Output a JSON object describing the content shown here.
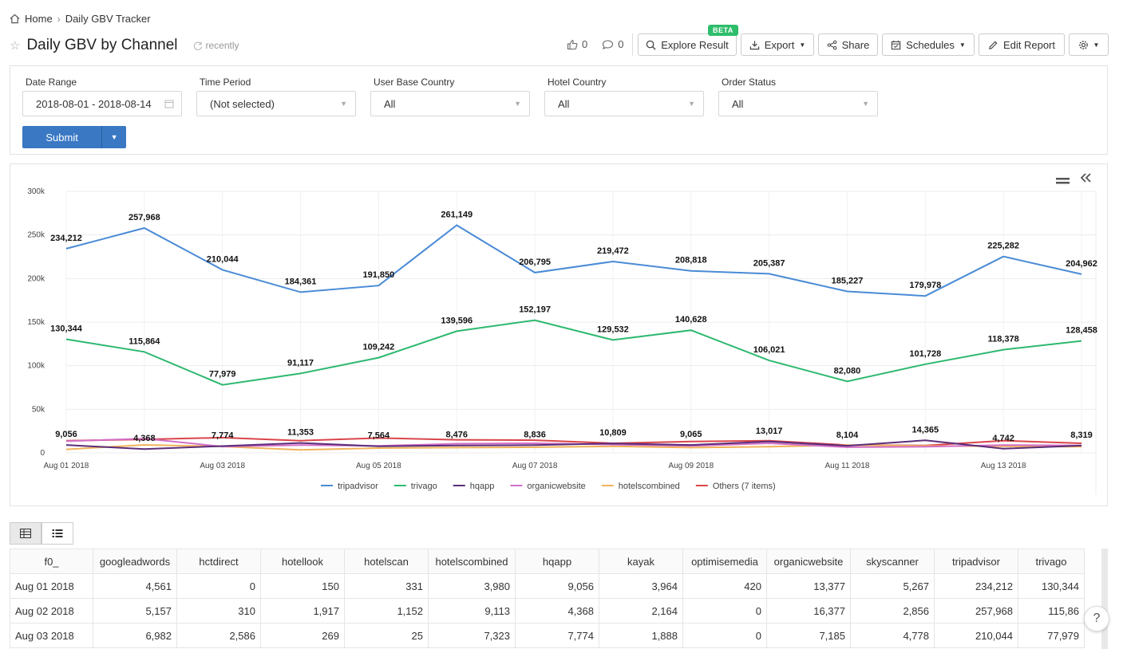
{
  "breadcrumb": {
    "home": "Home",
    "current": "Daily GBV Tracker"
  },
  "report": {
    "title": "Daily GBV by Channel",
    "refresh_text": "recently"
  },
  "counters": {
    "likes": "0",
    "comments": "0"
  },
  "toolbar": {
    "explore_label": "Explore Result",
    "beta_label": "BETA",
    "export_label": "Export",
    "share_label": "Share",
    "schedules_label": "Schedules",
    "edit_label": "Edit Report"
  },
  "filters": {
    "date_range": {
      "label": "Date Range",
      "value": "2018-08-01 - 2018-08-14"
    },
    "time_period": {
      "label": "Time Period",
      "value": "(Not selected)"
    },
    "user_base_country": {
      "label": "User Base Country",
      "value": "All"
    },
    "hotel_country": {
      "label": "Hotel Country",
      "value": "All"
    },
    "order_status": {
      "label": "Order Status",
      "value": "All"
    },
    "submit_label": "Submit"
  },
  "chart_data": {
    "type": "line",
    "x": [
      "Aug 01 2018",
      "Aug 02 2018",
      "Aug 03 2018",
      "Aug 04 2018",
      "Aug 05 2018",
      "Aug 06 2018",
      "Aug 07 2018",
      "Aug 08 2018",
      "Aug 09 2018",
      "Aug 10 2018",
      "Aug 11 2018",
      "Aug 12 2018",
      "Aug 13 2018",
      "Aug 14 2018"
    ],
    "x_tick_labels": [
      "Aug 01 2018",
      "Aug 03 2018",
      "Aug 05 2018",
      "Aug 07 2018",
      "Aug 09 2018",
      "Aug 11 2018",
      "Aug 13 2018"
    ],
    "y_ticks": [
      "0",
      "50k",
      "100k",
      "150k",
      "200k",
      "250k",
      "300k"
    ],
    "ylim": [
      0,
      300000
    ],
    "grid": true,
    "legend_position": "bottom",
    "series": [
      {
        "name": "tripadvisor",
        "color": "#4a8bd6",
        "labeled": true,
        "values": [
          234212,
          257968,
          210044,
          184361,
          191850,
          261149,
          206795,
          219472,
          208818,
          205387,
          185227,
          179978,
          225282,
          204962
        ],
        "labels": [
          "234,212",
          "257,968",
          "210,044",
          "184,361",
          "191,850",
          "261,149",
          "206,795",
          "219,472",
          "208,818",
          "205,387",
          "185,227",
          "179,978",
          "225,282",
          "204,962"
        ]
      },
      {
        "name": "trivago",
        "color": "#2eb870",
        "labeled": true,
        "values": [
          130344,
          115864,
          77979,
          91117,
          109242,
          139596,
          152197,
          129532,
          140628,
          106021,
          82080,
          101728,
          118378,
          128458
        ],
        "labels": [
          "130,344",
          "115,864",
          "77,979",
          "91,117",
          "109,242",
          "139,596",
          "152,197",
          "129,532",
          "140,628",
          "106,021",
          "82,080",
          "101,728",
          "118,378",
          "128,458"
        ]
      },
      {
        "name": "hqapp",
        "color": "#5b2d7a",
        "labeled": true,
        "values": [
          9056,
          4368,
          7774,
          11353,
          7564,
          8476,
          8836,
          10809,
          9065,
          13017,
          8104,
          14365,
          4742,
          8319
        ],
        "labels": [
          "9,056",
          "4,368",
          "7,774",
          "11,353",
          "7,564",
          "8,476",
          "8,836",
          "10,809",
          "9,065",
          "13,017",
          "8,104",
          "14,365",
          "4,742",
          "8,319"
        ]
      },
      {
        "name": "organicwebsite",
        "color": "#d36fc6",
        "labeled": false,
        "values": [
          13377,
          16377,
          7185,
          9000,
          8000,
          10500,
          11000,
          9500,
          8000,
          11000,
          6500,
          7000,
          9000,
          8500
        ]
      },
      {
        "name": "hotelscombined",
        "color": "#f0b35a",
        "labeled": false,
        "values": [
          3980,
          9113,
          7323,
          3500,
          5500,
          6000,
          6500,
          7500,
          6000,
          7000,
          9000,
          8000,
          7500,
          7000
        ]
      },
      {
        "name": "Others (7 items)",
        "color": "#d9454b",
        "labeled": false,
        "values": [
          14000,
          15500,
          17500,
          14000,
          17000,
          15000,
          14500,
          11000,
          13000,
          14000,
          9000,
          8500,
          14000,
          11000
        ]
      }
    ]
  },
  "view_toggle": {
    "table_icon": "table-icon",
    "list_icon": "list-icon"
  },
  "table": {
    "columns": [
      "f0_",
      "googleadwords",
      "hctdirect",
      "hotellook",
      "hotelscan",
      "hotelscombined",
      "hqapp",
      "kayak",
      "optimisemedia",
      "organicwebsite",
      "skyscanner",
      "tripadvisor",
      "trivago"
    ],
    "rows": [
      [
        "Aug 01 2018",
        "4,561",
        "0",
        "150",
        "331",
        "3,980",
        "9,056",
        "3,964",
        "420",
        "13,377",
        "5,267",
        "234,212",
        "130,344"
      ],
      [
        "Aug 02 2018",
        "5,157",
        "310",
        "1,917",
        "1,152",
        "9,113",
        "4,368",
        "2,164",
        "0",
        "16,377",
        "2,856",
        "257,968",
        "115,86"
      ],
      [
        "Aug 03 2018",
        "6,982",
        "2,586",
        "269",
        "25",
        "7,323",
        "7,774",
        "1,888",
        "0",
        "7,185",
        "4,778",
        "210,044",
        "77,979"
      ]
    ]
  },
  "help_label": "?"
}
